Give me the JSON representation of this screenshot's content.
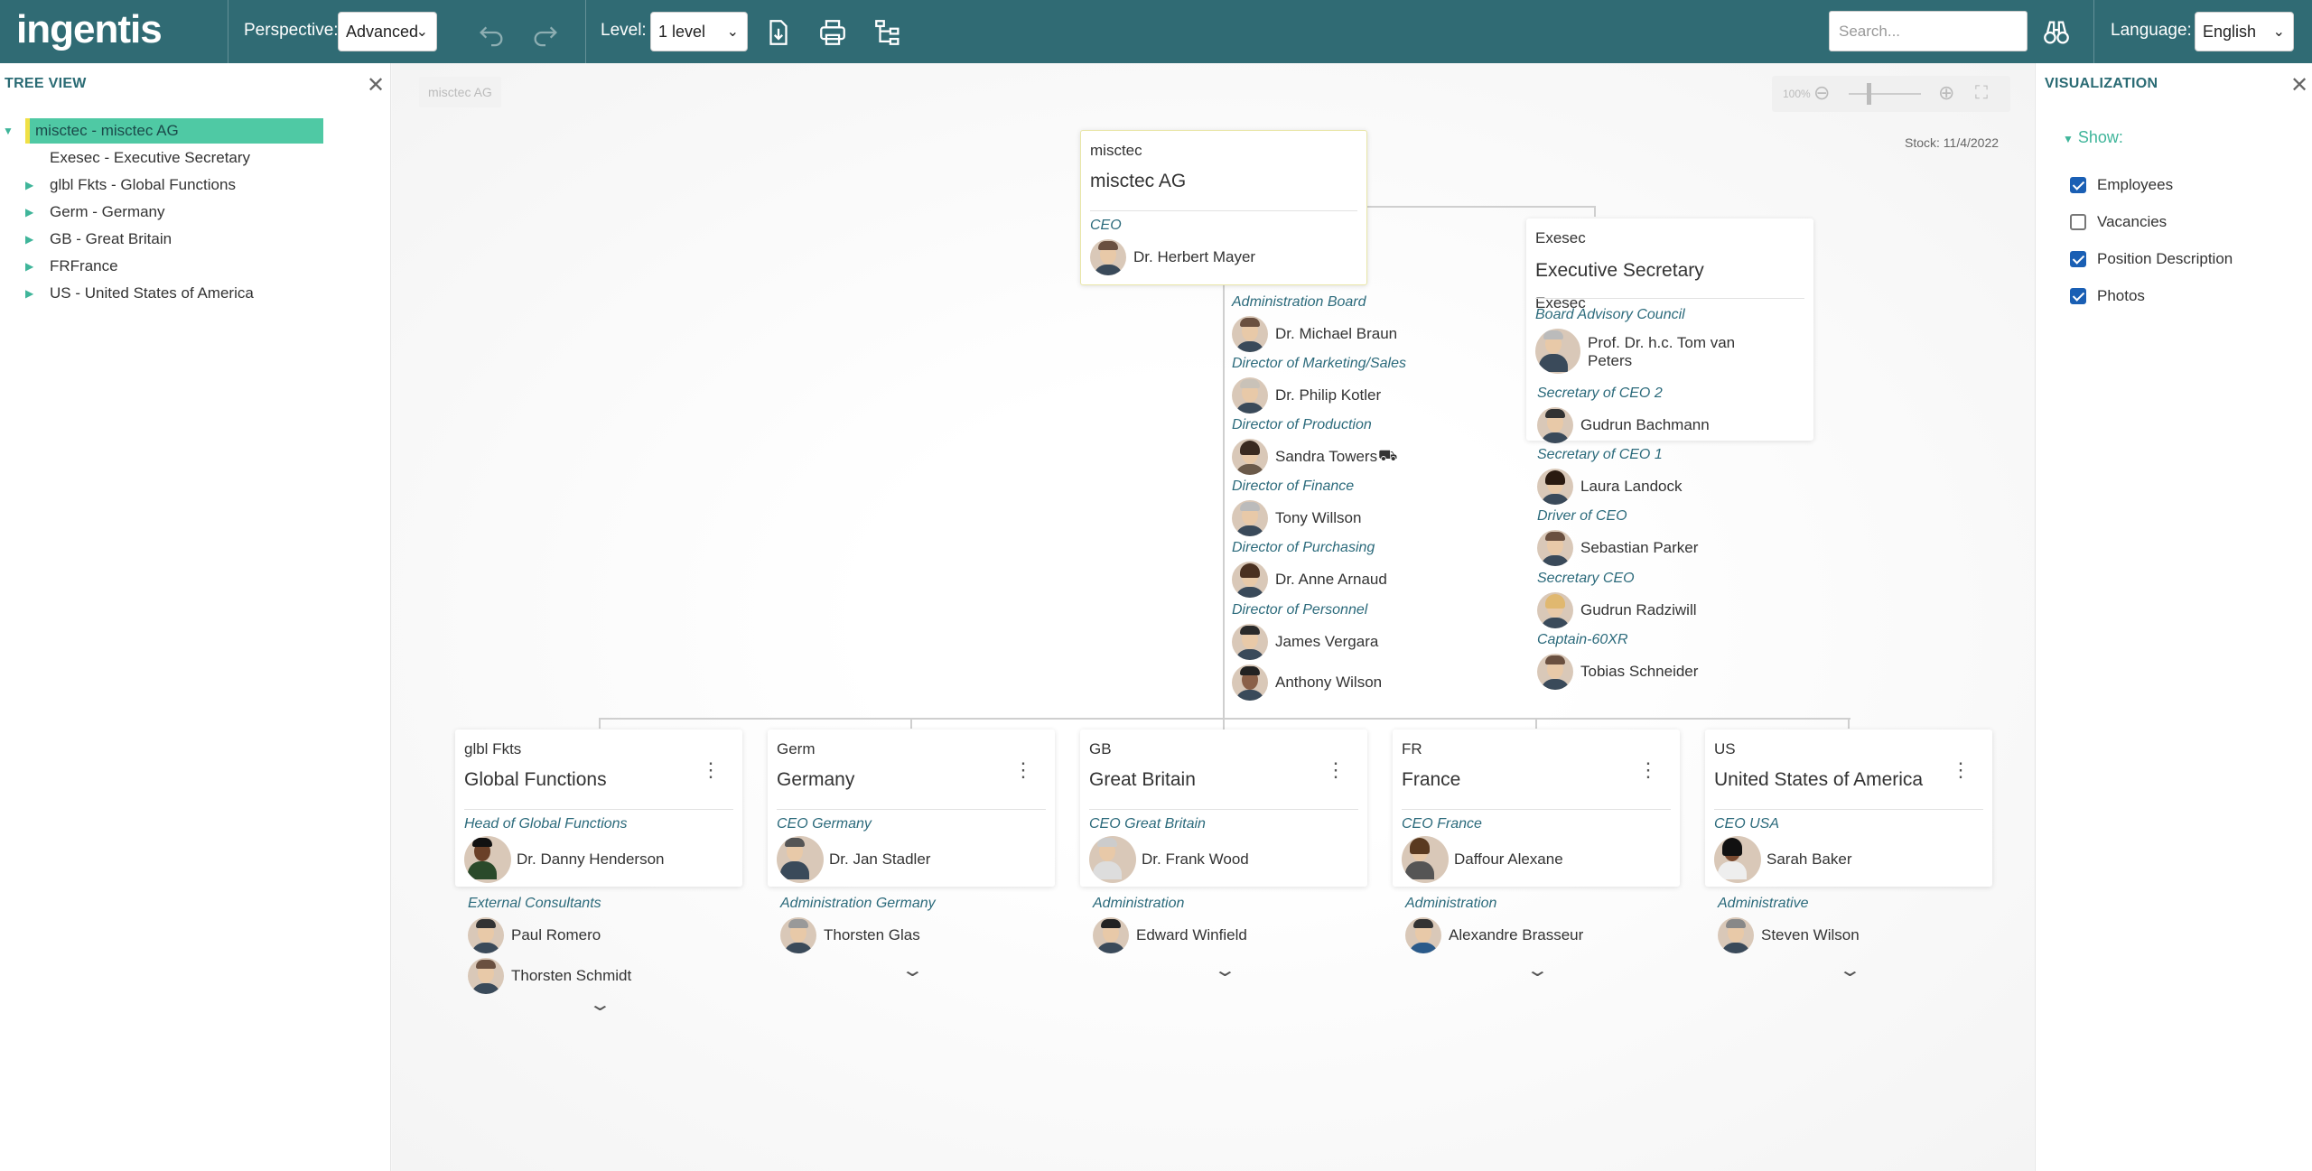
{
  "header": {
    "logo": "ingentis",
    "perspective_label": "Perspective:",
    "perspective_value": "Advanced",
    "level_label": "Level:",
    "level_value": "1 level",
    "search_placeholder": "Search...",
    "language_label": "Language:",
    "language_value": "English",
    "icons": [
      "undo-icon",
      "redo-icon",
      "export-icon",
      "print-icon",
      "structure-icon",
      "binoculars-icon"
    ],
    "colors": {
      "bar": "#306b74",
      "accent": "#3fb59a",
      "selected": "#4fc9a4"
    }
  },
  "tree_view": {
    "title": "TREE VIEW",
    "close": "✕",
    "items": [
      {
        "label": "misctec - misctec AG",
        "expanded": true,
        "selected": true
      },
      {
        "label": "Exesec - Executive Secretary"
      },
      {
        "label": "glbl Fkts - Global Functions"
      },
      {
        "label": "Germ - Germany"
      },
      {
        "label": "GB - Great Britain"
      },
      {
        "label": "FRFrance"
      },
      {
        "label": "US - United States of America"
      }
    ]
  },
  "visualization": {
    "title": "VISUALIZATION",
    "close": "✕",
    "show_label": "Show:",
    "options": [
      {
        "label": "Employees",
        "checked": true
      },
      {
        "label": "Vacancies",
        "checked": false
      },
      {
        "label": "Position Description",
        "checked": true
      },
      {
        "label": "Photos",
        "checked": true
      }
    ]
  },
  "canvas": {
    "breadcrumb": "misctec AG",
    "zoom_value": "100%",
    "stock": "Stock: 11/4/2022",
    "root": {
      "code": "misctec",
      "name": "misctec AG",
      "role": "CEO",
      "person": "Dr. Herbert Mayer"
    },
    "staff_left": [
      {
        "role": "Administration Board",
        "person": "Dr. Michael Braun"
      },
      {
        "role": "Director of Marketing/Sales",
        "person": "Dr. Philip Kotler"
      },
      {
        "role": "Director of Production",
        "person": "Sandra Towers"
      },
      {
        "role": "Director of Finance",
        "person": "Tony Willson"
      },
      {
        "role": "Director of Purchasing",
        "person": "Dr. Anne Arnaud"
      },
      {
        "role": "Director of Personnel",
        "person": "James Vergara"
      },
      {
        "role": "",
        "person": "Anthony Wilson"
      }
    ],
    "exesec": {
      "code": "Exesec",
      "name": "Executive Secretary",
      "role": "Board Advisory Council",
      "person_line1": "Prof. Dr. h.c. Tom van",
      "person_line2": "Peters"
    },
    "staff_right": [
      {
        "role": "Secretary of CEO 2",
        "person": "Gudrun Bachmann"
      },
      {
        "role": "Secretary of CEO 1",
        "person": "Laura Landock"
      },
      {
        "role": "Driver of CEO",
        "person": "Sebastian Parker"
      },
      {
        "role": "Secretary CEO",
        "person": "Gudrun Radziwill"
      },
      {
        "role": "Captain-60XR",
        "person": "Tobias Schneider"
      }
    ],
    "units": [
      {
        "code": "glbl Fkts",
        "name": "Global Functions",
        "role": "Head of Global Functions",
        "person": "Dr. Danny Henderson",
        "sub_role": "External Consultants",
        "sub_people": [
          "Paul Romero",
          "Thorsten Schmidt"
        ]
      },
      {
        "code": "Germ",
        "name": "Germany",
        "role": "CEO Germany",
        "person": "Dr. Jan Stadler",
        "sub_role": "Administration Germany",
        "sub_people": [
          "Thorsten Glas"
        ]
      },
      {
        "code": "GB",
        "name": "Great Britain",
        "role": "CEO Great Britain",
        "person": "Dr. Frank Wood",
        "sub_role": "Administration",
        "sub_people": [
          "Edward Winfield"
        ]
      },
      {
        "code": "FR",
        "name": "France",
        "role": "CEO France",
        "person": "Daffour Alexane",
        "sub_role": "Administration",
        "sub_people": [
          "Alexandre Brasseur"
        ]
      },
      {
        "code": "US",
        "name": "United States of America",
        "role": "CEO USA",
        "person": "Sarah Baker",
        "sub_role": "Administrative",
        "sub_people": [
          "Steven Wilson"
        ]
      }
    ]
  }
}
